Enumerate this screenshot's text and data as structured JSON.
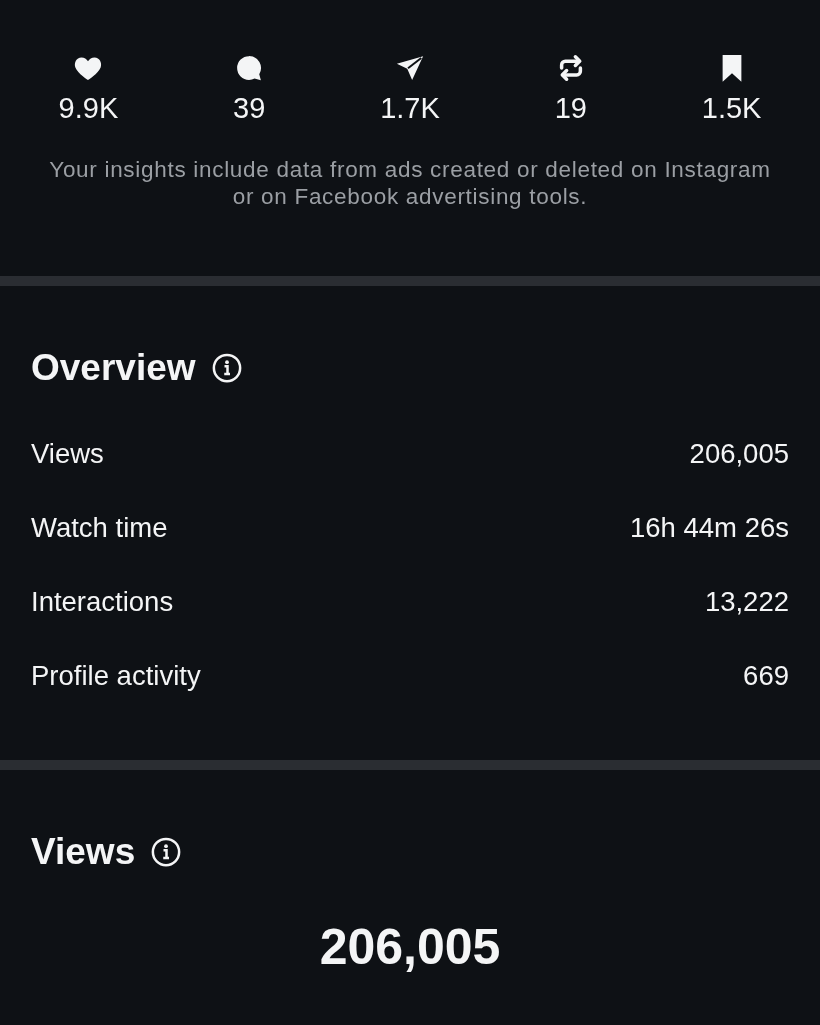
{
  "engagement": [
    {
      "kind": "likes",
      "count": "9.9K"
    },
    {
      "kind": "comments",
      "count": "39"
    },
    {
      "kind": "shares",
      "count": "1.7K"
    },
    {
      "kind": "reposts",
      "count": "19"
    },
    {
      "kind": "saves",
      "count": "1.5K"
    }
  ],
  "ads_note": "Your insights include data from ads created or deleted on Instagram or on Facebook advertising tools.",
  "overview": {
    "title": "Overview",
    "rows": [
      {
        "label": "Views",
        "value": "206,005"
      },
      {
        "label": "Watch time",
        "value": "16h 44m 26s"
      },
      {
        "label": "Interactions",
        "value": "13,222"
      },
      {
        "label": "Profile activity",
        "value": "669"
      }
    ]
  },
  "views": {
    "title": "Views",
    "total": "206,005"
  }
}
